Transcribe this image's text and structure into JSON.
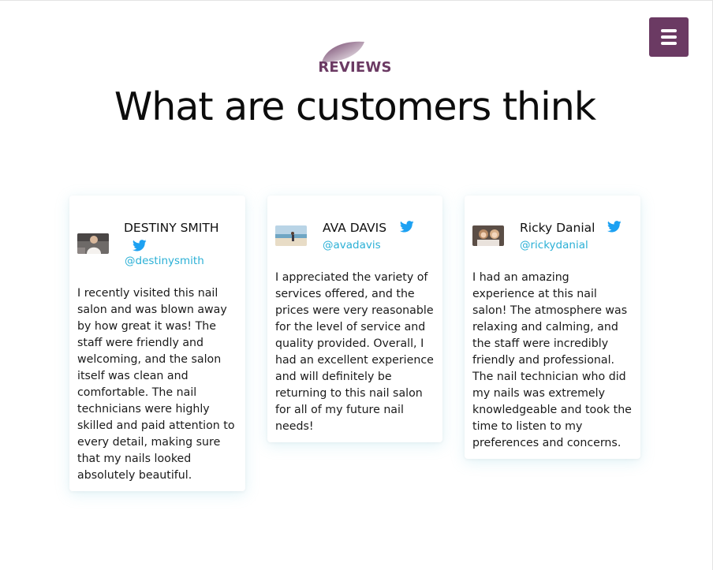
{
  "header": {
    "menu_icon": "hamburger-menu-icon",
    "brand_color": "#6b3a63"
  },
  "section": {
    "eyebrow": "REVIEWS",
    "title": "What are customers think"
  },
  "reviews": [
    {
      "name": "DESTINY SMITH",
      "handle": "@destinysmith",
      "avatar_icon": "avatar-photo",
      "social_icon": "twitter-icon",
      "text": "I recently visited this nail salon and was blown away by how great it was! The staff were friendly and welcoming, and the salon itself was clean and comfortable. The nail technicians were highly skilled and paid attention to every detail, making sure that my nails looked absolutely beautiful."
    },
    {
      "name": "AVA DAVIS",
      "handle": "@avadavis",
      "avatar_icon": "avatar-photo",
      "social_icon": "twitter-icon",
      "text": "I appreciated the variety of services offered, and the prices were very reasonable for the level of service and quality provided. Overall, I had an excellent experience and will definitely be returning to this nail salon for all of my future nail needs!"
    },
    {
      "name": "Ricky Danial",
      "handle": "@rickydanial",
      "avatar_icon": "avatar-photo",
      "social_icon": "twitter-icon",
      "text": "I had an amazing experience at this nail salon! The atmosphere was relaxing and calming, and the staff were incredibly friendly and professional. The nail technician who did my nails was extremely knowledgeable and took the time to listen to my preferences and concerns."
    }
  ],
  "colors": {
    "accent": "#6b3a63",
    "twitter": "#1da1f2",
    "handle": "#2bb0d6"
  }
}
